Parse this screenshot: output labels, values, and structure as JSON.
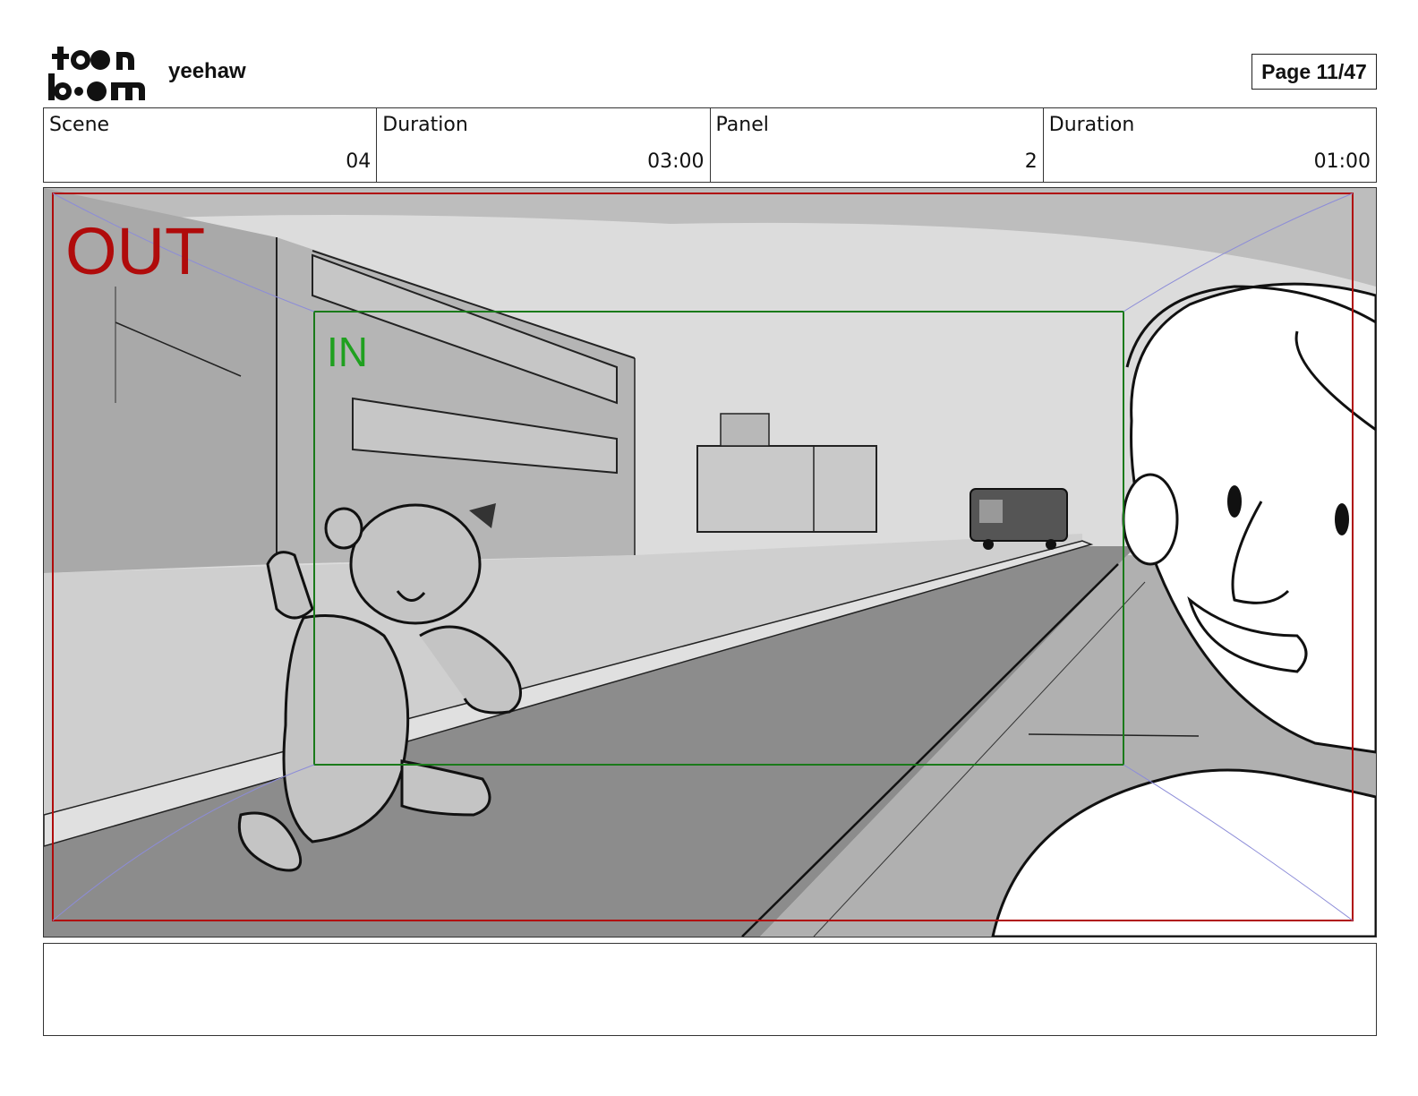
{
  "header": {
    "logo_name": "toon boom",
    "project_title": "yeehaw",
    "page_number": "Page 11/47"
  },
  "info": {
    "scene_label": "Scene",
    "scene_value": "04",
    "scene_duration_label": "Duration",
    "scene_duration_value": "03:00",
    "panel_label": "Panel",
    "panel_value": "2",
    "panel_duration_label": "Duration",
    "panel_duration_value": "01:00"
  },
  "frame": {
    "out_label": "OUT",
    "in_label": "IN",
    "out_color": "#b00b0b",
    "in_color": "#1fa01f"
  },
  "notes": {
    "text": ""
  }
}
